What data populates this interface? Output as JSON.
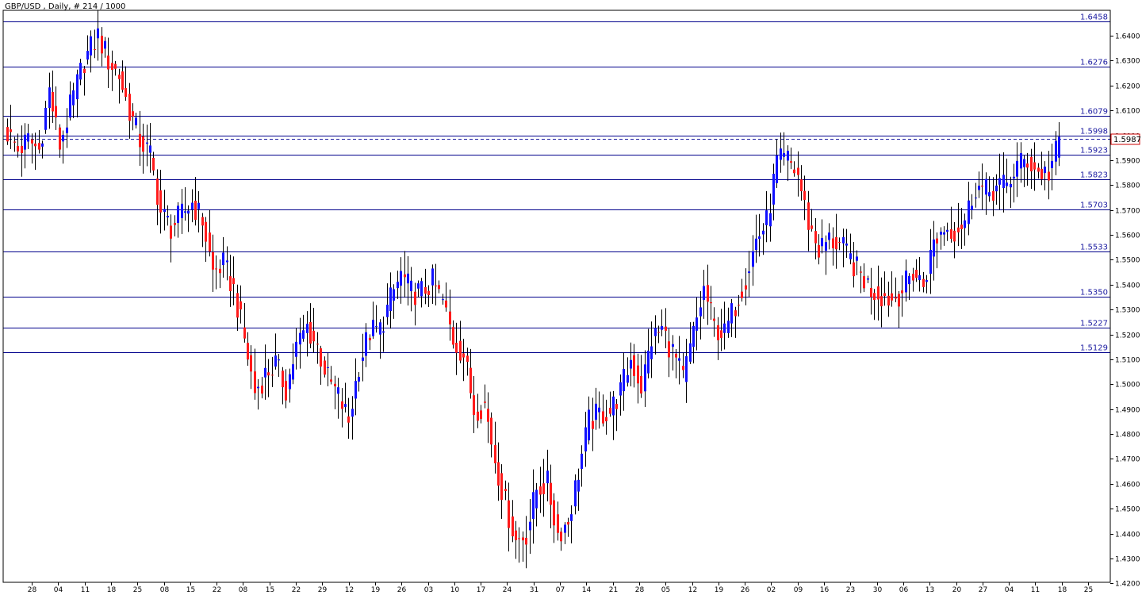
{
  "chart_data": {
    "type": "candlestick",
    "title": "GBP/USD , Daily, # 214 / 1000",
    "symbol": "GBP/USD",
    "timeframe": "Daily",
    "bars_info": "# 214 / 1000",
    "ylim": [
      1.4204,
      1.6502
    ],
    "y_ticks": [
      "1.6400",
      "1.6300",
      "1.6200",
      "1.6100",
      "1.6000",
      "1.5900",
      "1.5800",
      "1.5700",
      "1.5600",
      "1.5500",
      "1.5400",
      "1.5300",
      "1.5200",
      "1.5100",
      "1.5000",
      "1.4900",
      "1.4800",
      "1.4700",
      "1.4600",
      "1.4500",
      "1.4400",
      "1.4300",
      "1.4200"
    ],
    "x_ticks": [
      "28",
      "04",
      "11",
      "18",
      "25",
      "08",
      "15",
      "22",
      "08",
      "15",
      "22",
      "29",
      "12",
      "19",
      "26",
      "03",
      "10",
      "17",
      "24",
      "31",
      "07",
      "14",
      "21",
      "28",
      "05",
      "12",
      "19",
      "26",
      "02",
      "09",
      "16",
      "23",
      "30",
      "06",
      "13",
      "20",
      "27",
      "04",
      "11",
      "18",
      "25"
    ],
    "levels": [
      "1.6458",
      "1.6276",
      "1.6079",
      "1.5998",
      "1.5923",
      "1.5823",
      "1.5703",
      "1.5533",
      "1.5350",
      "1.5227",
      "1.5129"
    ],
    "current_price": "1.5987",
    "grid": false,
    "colors": {
      "bull": "#1010ff",
      "bear": "#ff1a1a",
      "level_line": "#00008b",
      "level_label": "#1a1aa0",
      "current_line": "#1a1aa0",
      "current_box": "#cc0000",
      "axis": "#000000",
      "background": "#ffffff"
    },
    "anchors": [
      [
        0,
        1.601
      ],
      [
        3,
        1.594
      ],
      [
        6,
        1.598
      ],
      [
        9,
        1.594
      ],
      [
        12,
        1.618
      ],
      [
        15,
        1.596
      ],
      [
        18,
        1.611
      ],
      [
        22,
        1.63
      ],
      [
        26,
        1.64
      ],
      [
        29,
        1.63
      ],
      [
        32,
        1.624
      ],
      [
        35,
        1.61
      ],
      [
        38,
        1.598
      ],
      [
        41,
        1.592
      ],
      [
        44,
        1.569
      ],
      [
        47,
        1.563
      ],
      [
        50,
        1.568
      ],
      [
        53,
        1.573
      ],
      [
        56,
        1.566
      ],
      [
        59,
        1.545
      ],
      [
        62,
        1.548
      ],
      [
        65,
        1.538
      ],
      [
        68,
        1.518
      ],
      [
        71,
        1.497
      ],
      [
        74,
        1.504
      ],
      [
        77,
        1.508
      ],
      [
        80,
        1.498
      ],
      [
        83,
        1.515
      ],
      [
        86,
        1.523
      ],
      [
        89,
        1.515
      ],
      [
        92,
        1.502
      ],
      [
        95,
        1.495
      ],
      [
        98,
        1.485
      ],
      [
        101,
        1.508
      ],
      [
        104,
        1.521
      ],
      [
        107,
        1.522
      ],
      [
        110,
        1.534
      ],
      [
        113,
        1.544
      ],
      [
        116,
        1.537
      ],
      [
        119,
        1.537
      ],
      [
        122,
        1.541
      ],
      [
        125,
        1.533
      ],
      [
        128,
        1.518
      ],
      [
        131,
        1.512
      ],
      [
        134,
        1.49
      ],
      [
        137,
        1.492
      ],
      [
        140,
        1.47
      ],
      [
        143,
        1.452
      ],
      [
        146,
        1.437
      ],
      [
        149,
        1.44
      ],
      [
        152,
        1.458
      ],
      [
        155,
        1.46
      ],
      [
        158,
        1.44
      ],
      [
        161,
        1.445
      ],
      [
        164,
        1.465
      ],
      [
        167,
        1.485
      ],
      [
        170,
        1.488
      ],
      [
        173,
        1.489
      ],
      [
        176,
        1.497
      ],
      [
        179,
        1.51
      ],
      [
        182,
        1.499
      ],
      [
        185,
        1.518
      ],
      [
        188,
        1.522
      ],
      [
        191,
        1.513
      ],
      [
        194,
        1.502
      ],
      [
        197,
        1.52
      ],
      [
        200,
        1.538
      ],
      [
        203,
        1.523
      ],
      [
        206,
        1.52
      ],
      [
        209,
        1.532
      ],
      [
        212,
        1.543
      ],
      [
        215,
        1.558
      ],
      [
        218,
        1.565
      ],
      [
        221,
        1.589
      ],
      [
        224,
        1.59
      ],
      [
        227,
        1.584
      ],
      [
        230,
        1.565
      ],
      [
        233,
        1.554
      ],
      [
        236,
        1.558
      ],
      [
        239,
        1.556
      ],
      [
        242,
        1.55
      ],
      [
        245,
        1.544
      ],
      [
        248,
        1.538
      ],
      [
        251,
        1.536
      ],
      [
        254,
        1.534
      ],
      [
        257,
        1.538
      ],
      [
        260,
        1.545
      ],
      [
        263,
        1.54
      ],
      [
        266,
        1.557
      ],
      [
        269,
        1.563
      ],
      [
        272,
        1.562
      ],
      [
        275,
        1.566
      ],
      [
        278,
        1.58
      ],
      [
        281,
        1.577
      ],
      [
        284,
        1.579
      ],
      [
        287,
        1.58
      ],
      [
        290,
        1.588
      ],
      [
        293,
        1.59
      ],
      [
        296,
        1.585
      ],
      [
        299,
        1.585
      ],
      [
        302,
        1.597
      ]
    ]
  }
}
